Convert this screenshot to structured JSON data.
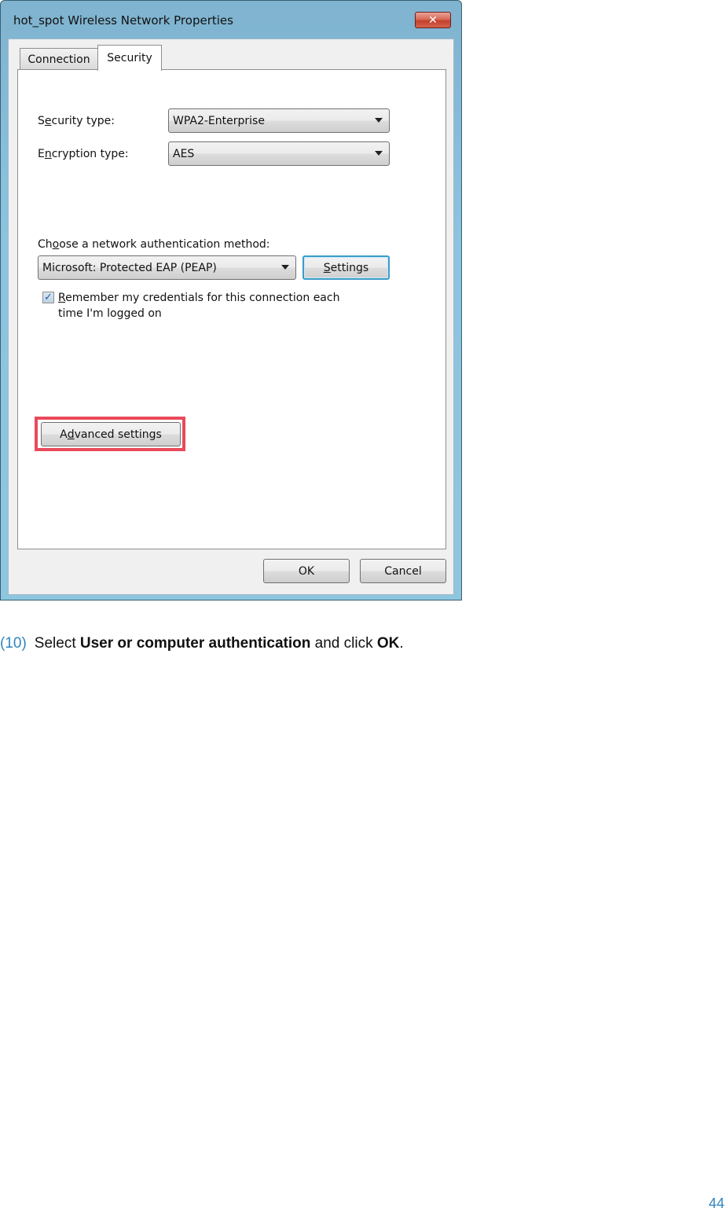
{
  "window": {
    "title": "hot_spot Wireless Network Properties",
    "close_icon": "close-x-icon",
    "tabs": [
      {
        "label": "Connection",
        "active": false
      },
      {
        "label": "Security",
        "active": true
      }
    ]
  },
  "security": {
    "security_type_label_pre": "S",
    "security_type_label_u": "e",
    "security_type_label_post": "curity type:",
    "security_type_value": "WPA2-Enterprise",
    "encryption_type_label_pre": "E",
    "encryption_type_label_u": "n",
    "encryption_type_label_post": "cryption type:",
    "encryption_type_value": "AES",
    "auth_method_label_pre": "Ch",
    "auth_method_label_u": "o",
    "auth_method_label_post": "ose a network authentication method:",
    "auth_method_value": "Microsoft: Protected EAP (PEAP)",
    "settings_button_u": "S",
    "settings_button_post": "ettings",
    "remember_checked": true,
    "remember_label_u": "R",
    "remember_label_line1": "emember my credentials for this connection each",
    "remember_label_line2": "time I'm logged on",
    "advanced_button_pre": "A",
    "advanced_button_u": "d",
    "advanced_button_post": "vanced settings"
  },
  "footer": {
    "ok_label": "OK",
    "cancel_label": "Cancel"
  },
  "instruction": {
    "step": "(10)",
    "text_1": "Select ",
    "bold_1": "User or computer authentication",
    "text_2": " and click ",
    "bold_2": "OK",
    "text_3": "."
  },
  "page_number": "44",
  "colors": {
    "highlight": "#e94a5b",
    "accent": "#2e86c1"
  }
}
